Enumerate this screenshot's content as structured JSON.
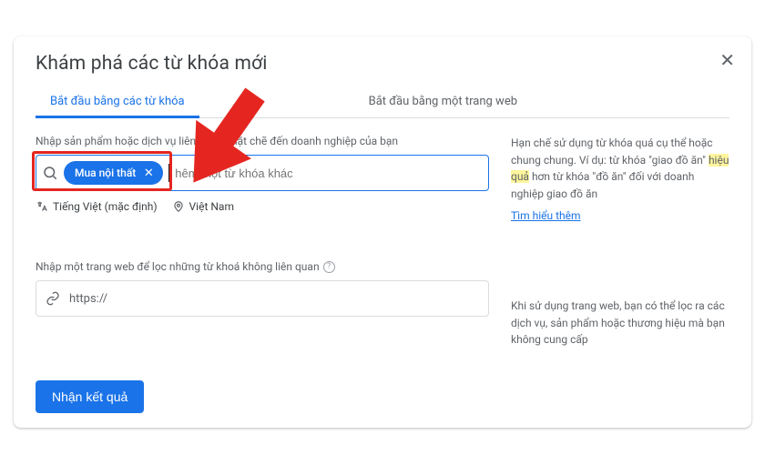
{
  "header": {
    "title": "Khám phá các từ khóa mới"
  },
  "tabs": {
    "tab1": "Bắt đầu bằng các từ khóa",
    "tab2": "Bắt đầu bằng một trang web"
  },
  "keywords": {
    "label": "Nhập sản phẩm hoặc dịch vụ liên quan chặt chẽ đến doanh nghiệp của bạn",
    "chip": "Mua nội thất",
    "placeholder": "Thêm một từ khóa khác",
    "display_placeholder": "hêm một từ khóa khác"
  },
  "locale": {
    "language": "Tiếng Việt (mặc định)",
    "location": "Việt Nam"
  },
  "tip1": {
    "pre": "Hạn chế sử dụng từ khóa quá cụ thể hoặc chung chung. Ví dụ: từ khóa \"giao đồ ăn\" ",
    "hl": "hiệu quả",
    "post": " hơn từ khóa \"đồ ăn\" đối với doanh nghiệp giao đồ ăn",
    "link": "Tìm hiểu thêm"
  },
  "urlfilter": {
    "label": "Nhập một trang web để lọc những từ khoá không liên quan",
    "value": "https://"
  },
  "tip2": "Khi sử dụng trang web, bạn có thể lọc ra các dịch vụ, sản phẩm hoặc thương hiệu mà bạn không cung cấp",
  "submit": "Nhận kết quả"
}
